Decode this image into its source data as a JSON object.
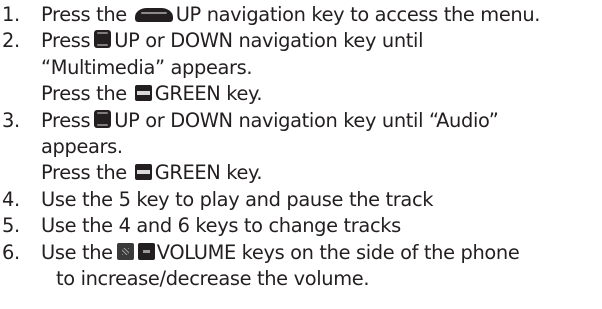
{
  "steps": [
    {
      "number": "1.",
      "lines": [
        {
          "before": "Press the",
          "icon": "up-key-icon",
          "after": "UP navigation key to access the menu."
        }
      ]
    },
    {
      "number": "2.",
      "lines": [
        {
          "before": "Press",
          "icon": "nav-key-icon",
          "after": "UP or DOWN navigation key until"
        },
        {
          "text": "“Multimedia” appears."
        },
        {
          "before": "Press the",
          "icon": "green-key-icon",
          "after": "GREEN key."
        }
      ]
    },
    {
      "number": "3.",
      "lines": [
        {
          "before": "Press",
          "icon": "nav-key-icon",
          "after": "UP or DOWN navigation key until “Audio”"
        },
        {
          "text": "appears."
        },
        {
          "before": "Press the",
          "icon": "green-key-icon",
          "after": "GREEN key."
        }
      ]
    },
    {
      "number": "4.",
      "lines": [
        {
          "text": "Use the 5 key to play and pause the track"
        }
      ]
    },
    {
      "number": "5.",
      "lines": [
        {
          "text": "Use the 4 and 6 keys to change tracks"
        }
      ]
    },
    {
      "number": "6.",
      "lines": [
        {
          "before": "Use the",
          "icon": "volume-keys-icon",
          "after": "VOLUME keys on the side of the phone"
        },
        {
          "text": "to increase/decrease the volume."
        }
      ]
    }
  ]
}
